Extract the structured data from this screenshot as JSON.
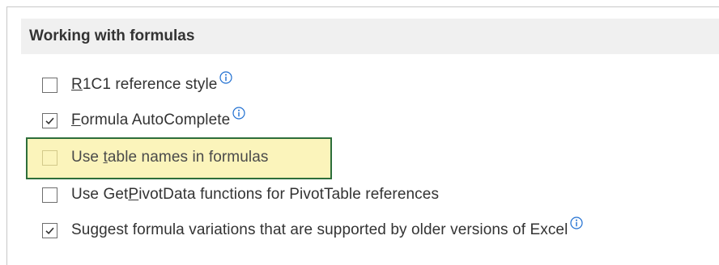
{
  "section": {
    "title": "Working with formulas"
  },
  "options": [
    {
      "pre": "",
      "u": "R",
      "post": "1C1 reference style",
      "checked": false,
      "info": true
    },
    {
      "pre": "",
      "u": "F",
      "post": "ormula AutoComplete",
      "checked": true,
      "info": true
    },
    {
      "pre": "Use ",
      "u": "t",
      "post": "able names in formulas",
      "checked": false,
      "info": false
    },
    {
      "pre": "Use Get",
      "u": "P",
      "post": "ivotData functions for PivotTable references",
      "checked": false,
      "info": false
    },
    {
      "pre": "Suggest formula variations that are supported by older versions of Excel",
      "u": "",
      "post": "",
      "checked": true,
      "info": true
    }
  ],
  "icons": {
    "info": "info-circle-icon",
    "check": "checkmark-icon"
  },
  "colors": {
    "highlight_fill": "#fbf4bb",
    "highlight_border": "#2d6e3a",
    "info_blue": "#1f6fd1"
  }
}
